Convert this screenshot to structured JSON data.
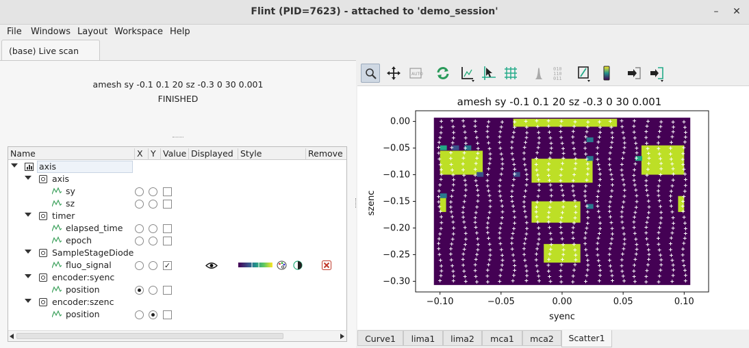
{
  "window": {
    "title": "Flint (PID=7623) - attached to 'demo_session'",
    "minimize": "–",
    "close": "✕"
  },
  "menu": [
    "File",
    "Windows",
    "Layout",
    "Workspace",
    "Help"
  ],
  "main_tab": "(base) Live scan",
  "scan": {
    "command": "amesh sy -0.1 0.1 20 sz -0.3 0 30 0.001",
    "status": "FINISHED"
  },
  "tree": {
    "headers": [
      "Name",
      "X",
      "Y",
      "Value",
      "Displayed",
      "Style",
      "Remove"
    ],
    "root": "axis",
    "groups": [
      {
        "label": "axis",
        "children": [
          "sy",
          "sz"
        ]
      },
      {
        "label": "timer",
        "children": [
          "elapsed_time",
          "epoch"
        ]
      },
      {
        "label": "SampleStageDiode",
        "children": [
          "fluo_signal"
        ]
      },
      {
        "label": "encoder:syenc",
        "children": [
          "position"
        ]
      },
      {
        "label": "encoder:szenc",
        "children": [
          "position"
        ]
      }
    ]
  },
  "toolbar_icons": [
    "zoom-icon",
    "pan-icon",
    "autoscale-icon",
    "refresh-icon",
    "axis-icon",
    "crosshair-icon",
    "grid-icon",
    "histogram-icon",
    "binary-icon",
    "colorbar-icon",
    "colormap-icon",
    "export-icon",
    "login-icon"
  ],
  "plot_tabs": [
    "Curve1",
    "lima1",
    "lima2",
    "mca1",
    "mca2",
    "Scatter1"
  ],
  "colors": {
    "purple": "#440154",
    "yellow": "#bddf26",
    "teal": "#2a788e",
    "blue": "#3b528b",
    "green": "#22a884"
  },
  "chart_data": {
    "type": "heatmap",
    "title": "amesh sy -0.1 0.1 20 sz -0.3 0 30 0.001",
    "xlabel": "syenc",
    "ylabel": "szenc",
    "xlim": [
      -0.12,
      0.12
    ],
    "ylim": [
      -0.32,
      0.02
    ],
    "xticks": [
      "−0.10",
      "−0.05",
      "0.00",
      "0.05",
      "0.10"
    ],
    "yticks": [
      "0.00",
      "−0.05",
      "−0.10",
      "−0.15",
      "−0.20",
      "−0.25",
      "−0.30"
    ],
    "x_values": [
      -0.105,
      -0.1,
      -0.05,
      0.0,
      0.05,
      0.1,
      0.105
    ],
    "y_values": [
      0.007,
      0.0,
      -0.05,
      -0.1,
      -0.15,
      -0.2,
      -0.25,
      -0.3,
      -0.307
    ],
    "background_value": "low",
    "high_regions": [
      {
        "x": [
          -0.04,
          0.045
        ],
        "y": [
          -0.01,
          0.005
        ]
      },
      {
        "x": [
          -0.1,
          -0.065
        ],
        "y": [
          -0.1,
          -0.055
        ]
      },
      {
        "x": [
          -0.025,
          0.025
        ],
        "y": [
          -0.115,
          -0.07
        ]
      },
      {
        "x": [
          0.065,
          0.1
        ],
        "y": [
          -0.1,
          -0.045
        ]
      },
      {
        "x": [
          -0.1,
          -0.095
        ],
        "y": [
          -0.17,
          -0.14
        ]
      },
      {
        "x": [
          -0.025,
          0.015
        ],
        "y": [
          -0.19,
          -0.15
        ]
      },
      {
        "x": [
          -0.015,
          0.015
        ],
        "y": [
          -0.265,
          -0.23
        ]
      },
      {
        "x": [
          0.095,
          0.1
        ],
        "y": [
          -0.17,
          -0.14
        ]
      }
    ]
  }
}
